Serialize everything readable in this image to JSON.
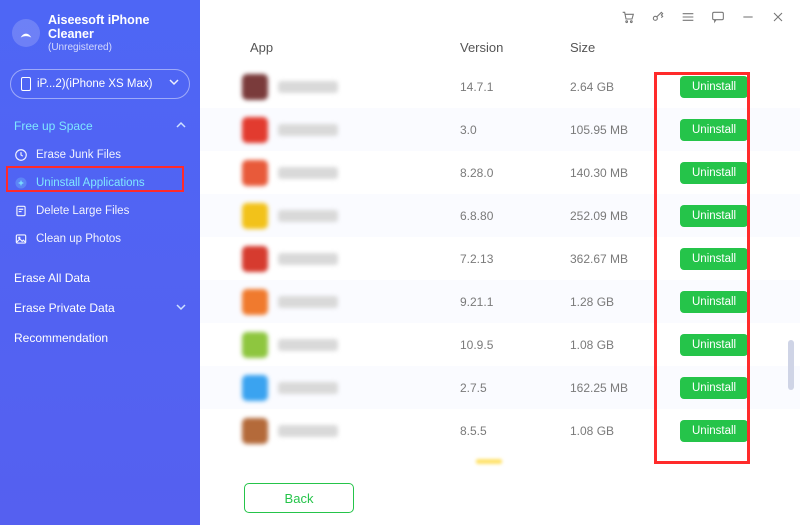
{
  "brand": {
    "title": "Aiseesoft iPhone",
    "subtitle": "Cleaner",
    "status": "(Unregistered)"
  },
  "device": {
    "label": "iP...2)(iPhone XS Max)"
  },
  "sidebar": {
    "section_free_label": "Free up Space",
    "items": [
      {
        "label": "Erase Junk Files"
      },
      {
        "label": "Uninstall Applications"
      },
      {
        "label": "Delete Large Files"
      },
      {
        "label": "Clean up Photos"
      }
    ],
    "section_erase_all": "Erase All Data",
    "section_erase_private": "Erase Private Data",
    "section_recommend": "Recommendation"
  },
  "colors": {
    "row_icons": [
      "#7a3b3b",
      "#e23b2f",
      "#e85a3a",
      "#f2c21a",
      "#d63b2f",
      "#f07a2e",
      "#8ec63f",
      "#3aa3f0",
      "#b46a3a"
    ]
  },
  "table": {
    "headers": {
      "app": "App",
      "version": "Version",
      "size": "Size"
    },
    "rows": [
      {
        "version": "14.7.1",
        "size": "2.64 GB"
      },
      {
        "version": "3.0",
        "size": "105.95 MB"
      },
      {
        "version": "8.28.0",
        "size": "140.30 MB"
      },
      {
        "version": "6.8.80",
        "size": "252.09 MB"
      },
      {
        "version": "7.2.13",
        "size": "362.67 MB"
      },
      {
        "version": "9.21.1",
        "size": "1.28 GB"
      },
      {
        "version": "10.9.5",
        "size": "1.08 GB"
      },
      {
        "version": "2.7.5",
        "size": "162.25 MB"
      },
      {
        "version": "8.5.5",
        "size": "1.08 GB"
      }
    ],
    "uninstall_label": "Uninstall"
  },
  "footer": {
    "back_label": "Back"
  }
}
